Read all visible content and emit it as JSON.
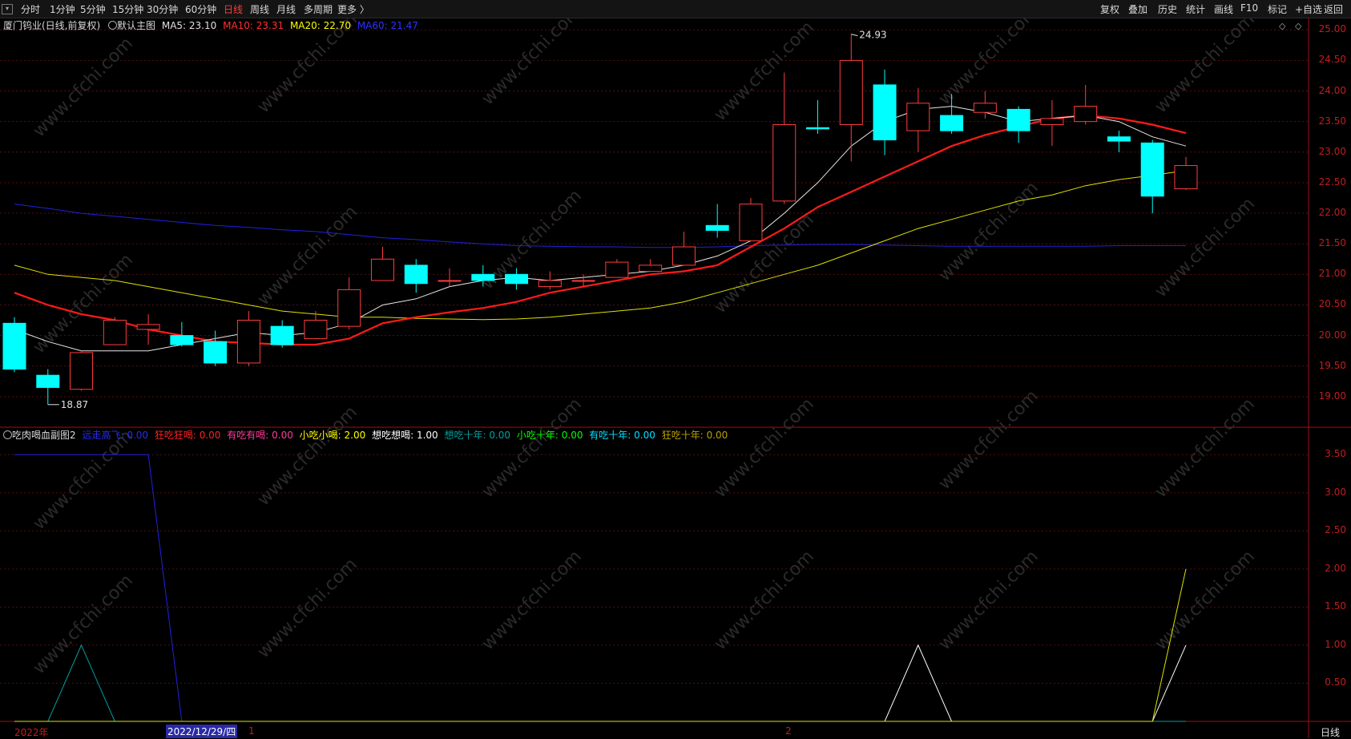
{
  "toolbar": {
    "periods": [
      "分时",
      "1分钟",
      "5分钟",
      "15分钟",
      "30分钟",
      "60分钟",
      "日线",
      "周线",
      "月线",
      "多周期",
      "更多 〉"
    ],
    "active": "日线",
    "right_buttons": [
      "复权",
      "叠加",
      "历史",
      "统计",
      "画线",
      "F10",
      "标记",
      "+自选",
      "返回"
    ]
  },
  "main": {
    "stock": "厦门钨业(日线,前复权)",
    "template": "默认主图",
    "ma": [
      {
        "label": "MA5: 23.10",
        "color": "#e0e0e0"
      },
      {
        "label": "MA10: 23.31",
        "color": "#ff3030"
      },
      {
        "label": "MA20: 22.70",
        "color": "#ffff00"
      },
      {
        "label": "MA60: 21.47",
        "color": "#3030ff"
      }
    ],
    "high_label": "24.93",
    "low_label": "18.87",
    "y_ticks": [
      "25.00",
      "24.50",
      "24.00",
      "23.50",
      "23.00",
      "22.50",
      "22.00",
      "21.50",
      "21.00",
      "20.50",
      "20.00",
      "19.50",
      "19.00"
    ]
  },
  "sub": {
    "name": "吃肉喝血副图2",
    "items": [
      {
        "label": "远走高飞: 0.00",
        "color": "#2a2af0"
      },
      {
        "label": "狂吃狂喝: 0.00",
        "color": "#ff2020"
      },
      {
        "label": "有吃有喝: 0.00",
        "color": "#ff3b9a"
      },
      {
        "label": "小吃小喝: 2.00",
        "color": "#ffff00"
      },
      {
        "label": "想吃想喝: 1.00",
        "color": "#ffffff"
      },
      {
        "label": "想吃十年: 0.00",
        "color": "#00a0a0"
      },
      {
        "label": "小吃十年: 0.00",
        "color": "#00ff00"
      },
      {
        "label": "有吃十年: 0.00",
        "color": "#00e0ff"
      },
      {
        "label": "狂吃十年: 0.00",
        "color": "#b8a000"
      }
    ],
    "y_ticks": [
      "3.50",
      "3.00",
      "2.50",
      "2.00",
      "1.50",
      "1.00",
      "0.50"
    ]
  },
  "xaxis": {
    "year_label": "2022年",
    "cursor_date": "2022/12/29/四",
    "month1": "1",
    "month2": "2",
    "period_label": "日线"
  },
  "watermark": "www.cfchi.com",
  "chart_data": {
    "type": "candlestick",
    "candles": [
      {
        "o": 20.2,
        "h": 20.3,
        "c": 19.45,
        "l": 19.4
      },
      {
        "o": 19.35,
        "h": 19.45,
        "c": 19.15,
        "l": 18.87
      },
      {
        "o": 19.12,
        "h": 19.75,
        "c": 19.72,
        "l": 19.1
      },
      {
        "o": 19.85,
        "h": 20.3,
        "c": 20.25,
        "l": 19.85
      },
      {
        "o": 20.1,
        "h": 20.35,
        "c": 20.18,
        "l": 19.85
      },
      {
        "o": 20.0,
        "h": 20.22,
        "c": 19.85,
        "l": 19.82
      },
      {
        "o": 19.9,
        "h": 20.08,
        "c": 19.55,
        "l": 19.5
      },
      {
        "o": 19.55,
        "h": 20.4,
        "c": 20.25,
        "l": 19.5
      },
      {
        "o": 20.15,
        "h": 20.25,
        "c": 19.85,
        "l": 19.8
      },
      {
        "o": 19.95,
        "h": 20.4,
        "c": 20.25,
        "l": 19.95
      },
      {
        "o": 20.15,
        "h": 20.95,
        "c": 20.75,
        "l": 20.1
      },
      {
        "o": 20.9,
        "h": 21.45,
        "c": 21.25,
        "l": 20.9
      },
      {
        "o": 21.15,
        "h": 21.25,
        "c": 20.85,
        "l": 20.7
      },
      {
        "o": 20.9,
        "h": 21.1,
        "c": 20.9,
        "l": 20.8
      },
      {
        "o": 21.0,
        "h": 21.15,
        "c": 20.9,
        "l": 20.8
      },
      {
        "o": 21.0,
        "h": 21.1,
        "c": 20.85,
        "l": 20.75
      },
      {
        "o": 20.8,
        "h": 21.05,
        "c": 20.9,
        "l": 20.75
      },
      {
        "o": 20.9,
        "h": 21.0,
        "c": 20.9,
        "l": 20.8
      },
      {
        "o": 20.95,
        "h": 21.25,
        "c": 21.2,
        "l": 20.95
      },
      {
        "o": 21.05,
        "h": 21.25,
        "c": 21.15,
        "l": 21.05
      },
      {
        "o": 21.15,
        "h": 21.7,
        "c": 21.45,
        "l": 21.15
      },
      {
        "o": 21.8,
        "h": 22.15,
        "c": 21.72,
        "l": 21.6
      },
      {
        "o": 21.55,
        "h": 22.25,
        "c": 22.15,
        "l": 21.55
      },
      {
        "o": 22.2,
        "h": 24.3,
        "c": 23.45,
        "l": 22.15
      },
      {
        "o": 23.4,
        "h": 23.85,
        "c": 23.38,
        "l": 23.3
      },
      {
        "o": 23.45,
        "h": 24.93,
        "c": 24.5,
        "l": 22.85
      },
      {
        "o": 24.1,
        "h": 24.35,
        "c": 23.2,
        "l": 22.95
      },
      {
        "o": 23.35,
        "h": 24.05,
        "c": 23.8,
        "l": 23.0
      },
      {
        "o": 23.6,
        "h": 23.95,
        "c": 23.35,
        "l": 23.3
      },
      {
        "o": 23.65,
        "h": 24.0,
        "c": 23.8,
        "l": 23.55
      },
      {
        "o": 23.7,
        "h": 23.75,
        "c": 23.35,
        "l": 23.15
      },
      {
        "o": 23.45,
        "h": 23.85,
        "c": 23.55,
        "l": 23.1
      },
      {
        "o": 23.5,
        "h": 24.1,
        "c": 23.75,
        "l": 23.45
      },
      {
        "o": 23.25,
        "h": 23.35,
        "c": 23.18,
        "l": 23.0
      },
      {
        "o": 23.15,
        "h": 23.2,
        "c": 22.28,
        "l": 22.0
      },
      {
        "o": 22.4,
        "h": 22.92,
        "c": 22.78,
        "l": 22.38
      }
    ],
    "ma5": [
      20.1,
      19.9,
      19.75,
      19.75,
      19.75,
      19.85,
      19.95,
      20.05,
      20.0,
      20.05,
      20.2,
      20.5,
      20.6,
      20.8,
      20.9,
      20.95,
      20.9,
      20.95,
      21.0,
      21.05,
      21.15,
      21.3,
      21.55,
      22.0,
      22.5,
      23.1,
      23.5,
      23.7,
      23.75,
      23.65,
      23.5,
      23.55,
      23.6,
      23.5,
      23.25,
      23.1
    ],
    "ma10": [
      20.7,
      20.5,
      20.35,
      20.25,
      20.1,
      20.0,
      19.9,
      19.88,
      19.85,
      19.85,
      19.95,
      20.2,
      20.3,
      20.38,
      20.45,
      20.55,
      20.7,
      20.8,
      20.9,
      21.0,
      21.05,
      21.15,
      21.45,
      21.75,
      22.1,
      22.35,
      22.6,
      22.85,
      23.1,
      23.28,
      23.42,
      23.55,
      23.6,
      23.55,
      23.45,
      23.31
    ],
    "ma20": [
      21.15,
      21.0,
      20.95,
      20.9,
      20.8,
      20.7,
      20.6,
      20.5,
      20.4,
      20.35,
      20.3,
      20.3,
      20.28,
      20.27,
      20.26,
      20.27,
      20.3,
      20.35,
      20.4,
      20.45,
      20.55,
      20.7,
      20.85,
      21.0,
      21.15,
      21.35,
      21.55,
      21.75,
      21.9,
      22.05,
      22.2,
      22.3,
      22.45,
      22.55,
      22.62,
      22.7
    ],
    "ma60": [
      22.15,
      22.08,
      22.0,
      21.95,
      21.9,
      21.85,
      21.8,
      21.77,
      21.73,
      21.7,
      21.65,
      21.6,
      21.57,
      21.53,
      21.5,
      21.47,
      21.46,
      21.45,
      21.45,
      21.44,
      21.44,
      21.45,
      21.47,
      21.48,
      21.49,
      21.49,
      21.48,
      21.47,
      21.46,
      21.46,
      21.46,
      21.46,
      21.46,
      21.47,
      21.47,
      21.47
    ],
    "sub_yellow": [
      0,
      0,
      0,
      0,
      0,
      0,
      0,
      0,
      0,
      0,
      0,
      0,
      0,
      0,
      0,
      0,
      0,
      0,
      0,
      0,
      0,
      0,
      0,
      0,
      0,
      0,
      0,
      0,
      0,
      0,
      0,
      0,
      0,
      0,
      0,
      2
    ],
    "sub_white": [
      0,
      0,
      0,
      0,
      0,
      0,
      0,
      0,
      0,
      0,
      0,
      0,
      0,
      0,
      0,
      0,
      0,
      0,
      0,
      0,
      0,
      0,
      0,
      0,
      0,
      0,
      0,
      1,
      0,
      0,
      0,
      0,
      0,
      0,
      0,
      1
    ],
    "sub_teal": [
      0,
      0,
      1,
      0,
      0,
      0,
      0,
      0,
      0,
      0,
      0,
      0,
      0,
      0,
      0,
      0,
      0,
      0,
      0,
      0,
      0,
      0,
      0,
      0,
      0,
      0,
      0,
      0,
      0,
      0,
      0,
      0,
      0,
      0,
      0,
      0
    ],
    "sub_blue": [
      3.5,
      3.5,
      3.5,
      3.5,
      3.5,
      0,
      0,
      0,
      0,
      0,
      0,
      0,
      0,
      0,
      0,
      0,
      0,
      0,
      0,
      0,
      0,
      0,
      0,
      0,
      0,
      0,
      0,
      0,
      0,
      0,
      0,
      0,
      0,
      0,
      0,
      0
    ],
    "main_ylim": [
      18.5,
      25.2
    ],
    "sub_ylim": [
      0,
      3.65
    ]
  }
}
